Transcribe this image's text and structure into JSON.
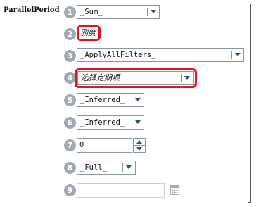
{
  "function_name": "ParallelPeriod",
  "params": [
    {
      "index": "1",
      "type": "dropdown",
      "value": "_Sum_"
    },
    {
      "index": "2",
      "type": "measure",
      "value": "测度"
    },
    {
      "index": "3",
      "type": "dropdown",
      "value": "_ApplyAllFilters_"
    },
    {
      "index": "4",
      "type": "dropdown",
      "value": "选择定期项"
    },
    {
      "index": "5",
      "type": "dropdown",
      "value": "_Inferred_"
    },
    {
      "index": "6",
      "type": "dropdown",
      "value": "_Inferred_"
    },
    {
      "index": "7",
      "type": "spinner",
      "value": "0"
    },
    {
      "index": "8",
      "type": "dropdown",
      "value": "_Full_"
    },
    {
      "index": "9",
      "type": "date",
      "value": ""
    }
  ],
  "icons": {
    "dropdown": "chevron-down-icon",
    "spin_up": "arrow-up-icon",
    "spin_down": "arrow-down-icon",
    "date": "calendar-icon"
  },
  "colors": {
    "highlight": "#e3161c",
    "badge": "#a3a9b3",
    "arrow": "#2b4f86"
  }
}
